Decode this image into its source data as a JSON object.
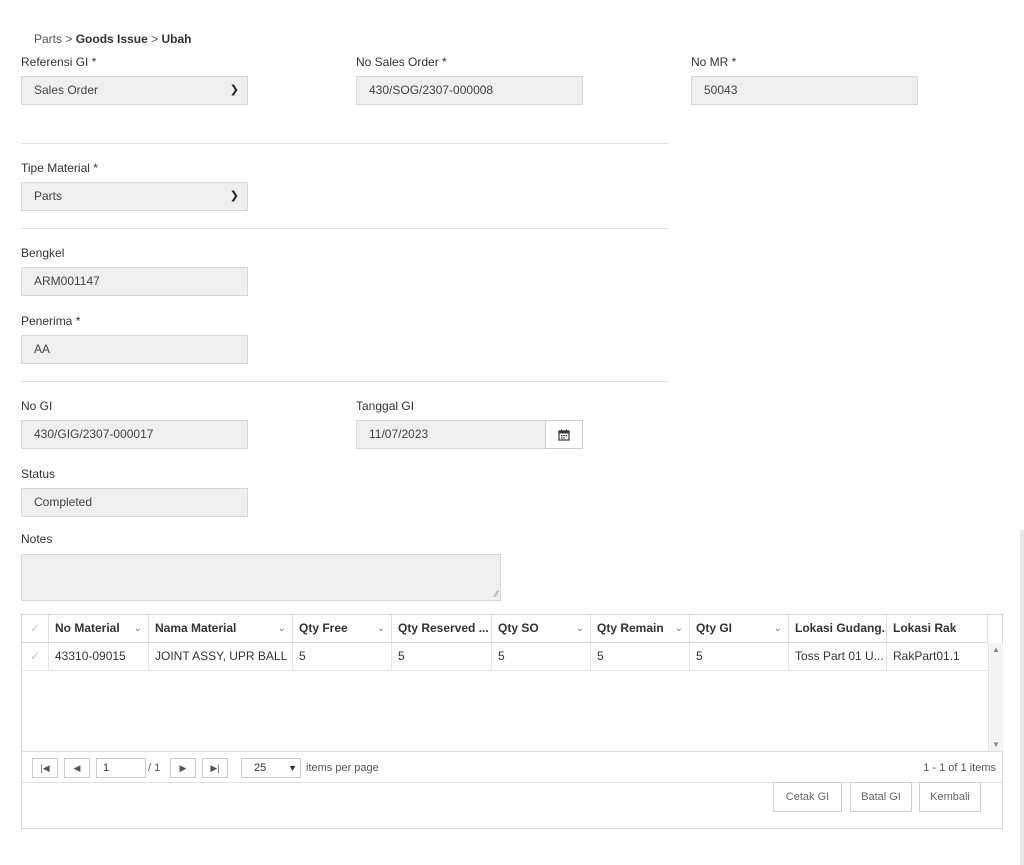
{
  "breadcrumb": {
    "root": "Parts",
    "sep1": ">",
    "section": "Goods Issue",
    "sep2": ">",
    "current": "Ubah"
  },
  "form": {
    "referensi_gi": {
      "label": "Referensi GI *",
      "value": "Sales Order"
    },
    "no_sales_order": {
      "label": "No Sales Order *",
      "value": "430/SOG/2307-000008"
    },
    "no_mr": {
      "label": "No MR *",
      "value": "50043"
    },
    "tipe_material": {
      "label": "Tipe Material *",
      "value": "Parts"
    },
    "bengkel": {
      "label": "Bengkel",
      "value": "ARM001147"
    },
    "penerima": {
      "label": "Penerima *",
      "value": "AA"
    },
    "no_gi": {
      "label": "No GI",
      "value": "430/GIG/2307-000017"
    },
    "tanggal_gi": {
      "label": "Tanggal GI",
      "value": "11/07/2023"
    },
    "status": {
      "label": "Status",
      "value": "Completed"
    },
    "notes": {
      "label": "Notes",
      "value": ""
    }
  },
  "grid": {
    "columns": [
      "No Material",
      "Nama Material",
      "Qty Free",
      "Qty Reserved ...",
      "Qty SO",
      "Qty Remain",
      "Qty GI",
      "Lokasi Gudang...",
      "Lokasi Rak"
    ],
    "rows": [
      [
        "43310-09015",
        "JOINT ASSY, UPR BALL",
        "5",
        "5",
        "5",
        "5",
        "5",
        "Toss Part 01 U...",
        "RakPart01.1"
      ]
    ]
  },
  "pager": {
    "page": "1",
    "of": "/ 1",
    "page_size": "25",
    "items_per_page": "items per page",
    "info": "1 - 1 of 1 items"
  },
  "actions": {
    "cetak": "Cetak GI",
    "batal": "Batal GI",
    "kembali": "Kembali"
  },
  "icons": {
    "calendar": "calendar-icon",
    "chevron": "chevron-down-icon"
  }
}
